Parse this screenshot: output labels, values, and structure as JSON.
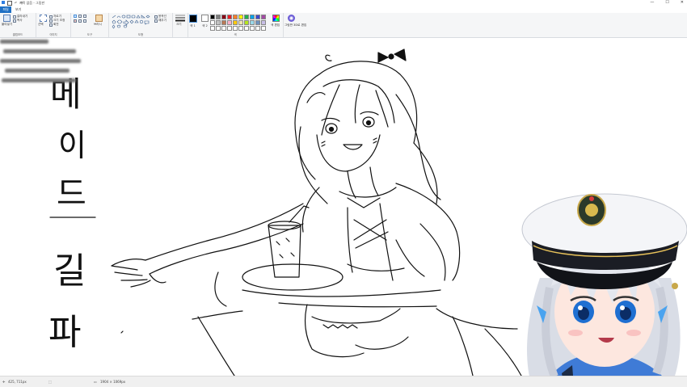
{
  "window": {
    "title": "제목 없음 - 그림판",
    "controls": [
      "—",
      "☐",
      "✕"
    ]
  },
  "tabs": {
    "file": "파일",
    "view": "보기"
  },
  "ribbon": {
    "clipboard": {
      "label": "클립보드",
      "paste": "붙여넣기",
      "cut": "잘라내기",
      "copy": "복사"
    },
    "image": {
      "label": "이미지",
      "select": "선택",
      "crop": "자르기",
      "resize": "크기 조정",
      "rotate": "회전"
    },
    "tools": {
      "label": "도구",
      "brushes": "브러시"
    },
    "shapes": {
      "label": "도형",
      "outline": "윤곽선",
      "fill": "채우기"
    },
    "size": "크기",
    "colors": {
      "label": "색",
      "color1": "색 1",
      "color2": "색 2",
      "edit": "색 편집"
    },
    "paint3d": "그림판 3D로 편집"
  },
  "palette": [
    "#000000",
    "#7f7f7f",
    "#880015",
    "#ed1c24",
    "#ff7f27",
    "#fff200",
    "#22b14c",
    "#00a2e8",
    "#3f48cc",
    "#a349a4",
    "#ffffff",
    "#c3c3c3",
    "#b97a57",
    "#ffaec9",
    "#ffc90e",
    "#efe4b0",
    "#b5e61d",
    "#99d9ea",
    "#7092be",
    "#c8bfe7",
    "#ffffff",
    "#ffffff",
    "#ffffff",
    "#ffffff",
    "#ffffff",
    "#ffffff",
    "#ffffff",
    "#ffffff",
    "#ffffff",
    "#ffffff"
  ],
  "canvas": {
    "vertical_text": [
      "메",
      "이",
      "드",
      "길",
      "파"
    ]
  },
  "status": {
    "cursor": "425, 711px",
    "size": "1904 × 1069px"
  }
}
